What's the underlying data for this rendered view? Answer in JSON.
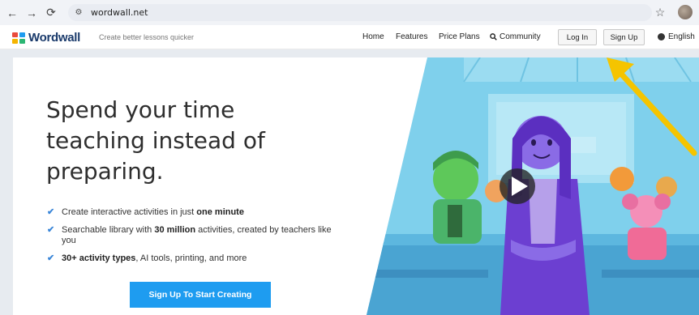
{
  "browser": {
    "back_icon": "arrow-left-icon",
    "forward_icon": "arrow-right-icon",
    "reload_icon": "reload-icon",
    "url": "wordwall.net"
  },
  "header": {
    "logo_text": "Wordwall",
    "tagline": "Create better lessons quicker",
    "menu": [
      "Home",
      "Features",
      "Price Plans",
      "Community"
    ],
    "login_label": "Log In",
    "signup_label": "Sign Up",
    "language": "English"
  },
  "hero": {
    "headline": "Spend your time teaching instead of preparing.",
    "features": [
      {
        "pre": "Create interactive activities in just ",
        "bold": "one minute",
        "post": ""
      },
      {
        "pre": "Searchable library with ",
        "bold": "30 million",
        "post": " activities, created by teachers like you"
      },
      {
        "pre": "",
        "bold": "30+ activity types",
        "post": ", AI tools, printing, and more"
      }
    ],
    "cta_label": "Sign Up To Start Creating"
  },
  "colors": {
    "brand_navy": "#1a3a6b",
    "cta_blue": "#1e9cf0",
    "check_blue": "#3a86d8",
    "arrow_yellow": "#f5c400"
  }
}
